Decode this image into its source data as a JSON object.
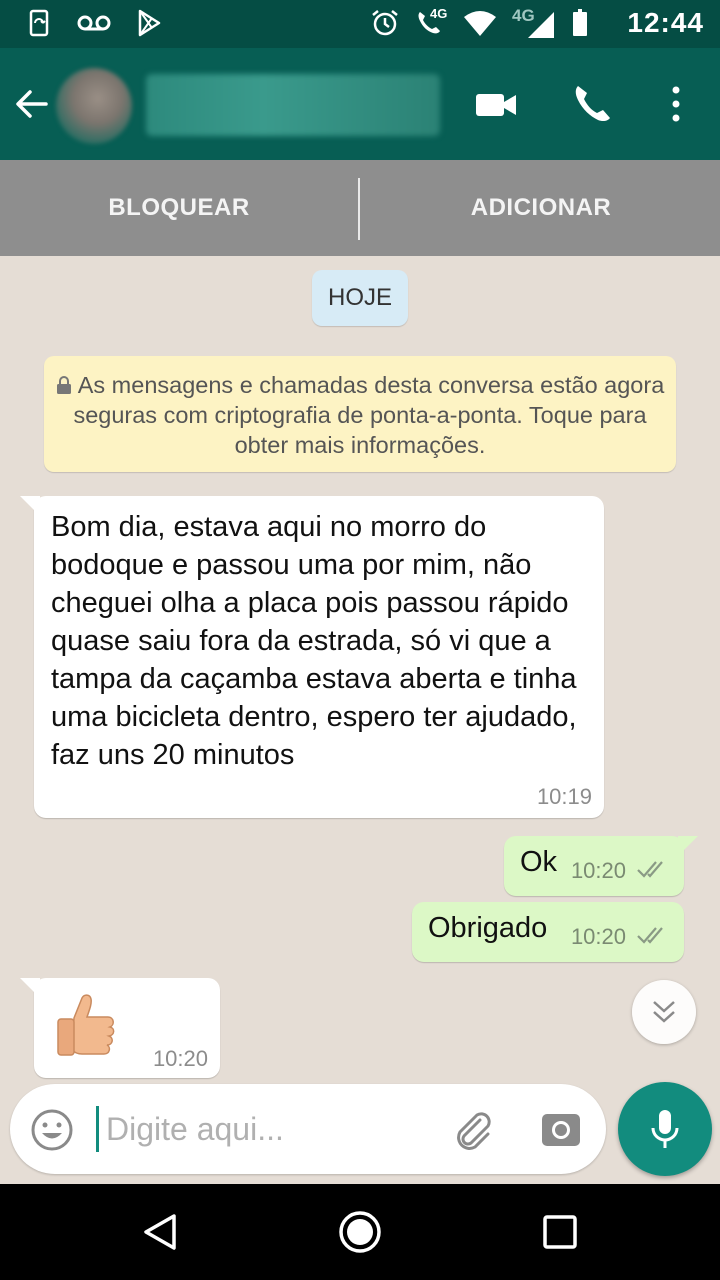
{
  "status_bar": {
    "time": "12:44",
    "network_label": "4G",
    "network_label_small": "4G",
    "icons": [
      "screen-sync-icon",
      "voicemail-icon",
      "play-store-icon",
      "alarm-icon",
      "wifi-calling-icon",
      "wifi-icon",
      "signal-icon",
      "battery-icon"
    ]
  },
  "app_bar": {
    "contact_name": "",
    "icons": [
      "back-arrow-icon",
      "video-call-icon",
      "phone-icon",
      "more-vertical-icon"
    ]
  },
  "action_bar": {
    "block_label": "BLOQUEAR",
    "add_label": "ADICIONAR"
  },
  "chat": {
    "date_chip": "HOJE",
    "encryption_notice": "As mensagens e chamadas desta conversa estão agora seguras com criptografia de ponta-a-ponta. Toque para obter mais informações.",
    "messages": [
      {
        "direction": "incoming",
        "text": "Bom dia, estava aqui no morro do bodoque e passou uma por mim, não cheguei olha a placa pois passou rápido quase saiu fora da estrada, só vi que a tampa da caçamba estava aberta e tinha uma bicicleta dentro, espero ter ajudado, faz uns 20 minutos",
        "time": "10:19"
      },
      {
        "direction": "outgoing",
        "text": "Ok",
        "time": "10:20",
        "status": "read"
      },
      {
        "direction": "outgoing",
        "text": "Obrigado",
        "time": "10:20",
        "status": "read"
      },
      {
        "direction": "incoming",
        "emoji": "thumbs-up",
        "time": "10:20"
      }
    ]
  },
  "composer": {
    "placeholder": "Digite aqui...",
    "value": ""
  },
  "colors": {
    "status_bar": "#054d44",
    "app_bar": "#075e54",
    "accent": "#128c7e",
    "outgoing_bubble": "#dcf8c6",
    "incoming_bubble": "#ffffff",
    "notice_bg": "#fdf3c4",
    "date_chip_bg": "#d7ebf6"
  }
}
